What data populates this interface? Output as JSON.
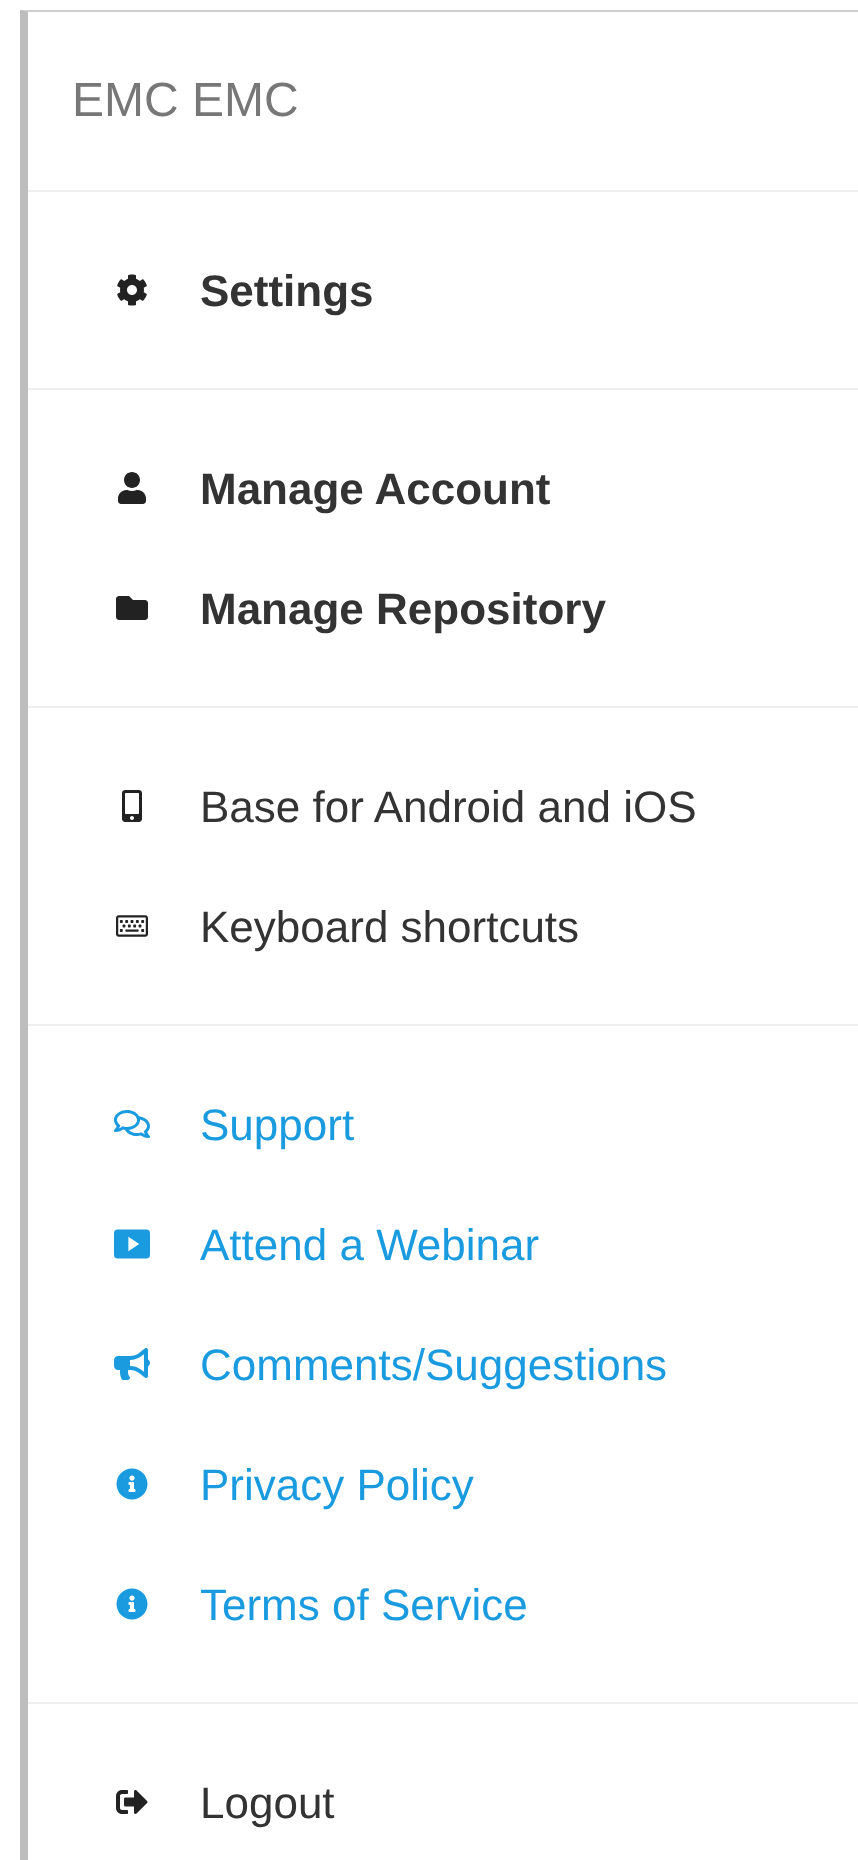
{
  "header": {
    "title": "EMC EMC"
  },
  "groups": [
    {
      "items": [
        {
          "label": "Settings",
          "kind": "bold"
        }
      ]
    },
    {
      "items": [
        {
          "label": "Manage Account",
          "kind": "bold"
        },
        {
          "label": "Manage Repository",
          "kind": "bold"
        }
      ]
    },
    {
      "items": [
        {
          "label": "Base for Android and iOS",
          "kind": "plain"
        },
        {
          "label": "Keyboard shortcuts",
          "kind": "plain"
        }
      ]
    },
    {
      "items": [
        {
          "label": "Support",
          "kind": "link"
        },
        {
          "label": "Attend a Webinar",
          "kind": "link"
        },
        {
          "label": "Comments/Suggestions",
          "kind": "link"
        },
        {
          "label": "Privacy Policy",
          "kind": "link"
        },
        {
          "label": "Terms of Service",
          "kind": "link"
        }
      ]
    },
    {
      "items": [
        {
          "label": "Logout",
          "kind": "plain"
        }
      ]
    }
  ]
}
